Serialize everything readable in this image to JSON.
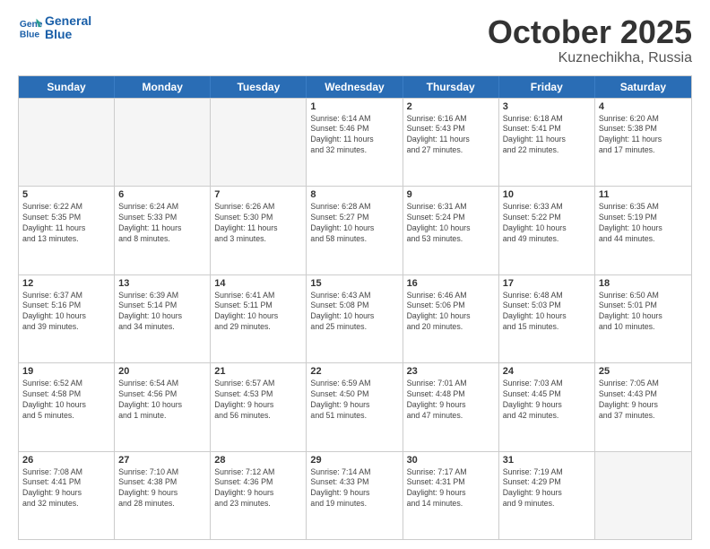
{
  "header": {
    "logo_line1": "General",
    "logo_line2": "Blue",
    "month": "October 2025",
    "location": "Kuznechikha, Russia"
  },
  "days_of_week": [
    "Sunday",
    "Monday",
    "Tuesday",
    "Wednesday",
    "Thursday",
    "Friday",
    "Saturday"
  ],
  "rows": [
    [
      {
        "day": "",
        "info": "",
        "empty": true
      },
      {
        "day": "",
        "info": "",
        "empty": true
      },
      {
        "day": "",
        "info": "",
        "empty": true
      },
      {
        "day": "1",
        "info": "Sunrise: 6:14 AM\nSunset: 5:46 PM\nDaylight: 11 hours\nand 32 minutes."
      },
      {
        "day": "2",
        "info": "Sunrise: 6:16 AM\nSunset: 5:43 PM\nDaylight: 11 hours\nand 27 minutes."
      },
      {
        "day": "3",
        "info": "Sunrise: 6:18 AM\nSunset: 5:41 PM\nDaylight: 11 hours\nand 22 minutes."
      },
      {
        "day": "4",
        "info": "Sunrise: 6:20 AM\nSunset: 5:38 PM\nDaylight: 11 hours\nand 17 minutes."
      }
    ],
    [
      {
        "day": "5",
        "info": "Sunrise: 6:22 AM\nSunset: 5:35 PM\nDaylight: 11 hours\nand 13 minutes."
      },
      {
        "day": "6",
        "info": "Sunrise: 6:24 AM\nSunset: 5:33 PM\nDaylight: 11 hours\nand 8 minutes."
      },
      {
        "day": "7",
        "info": "Sunrise: 6:26 AM\nSunset: 5:30 PM\nDaylight: 11 hours\nand 3 minutes."
      },
      {
        "day": "8",
        "info": "Sunrise: 6:28 AM\nSunset: 5:27 PM\nDaylight: 10 hours\nand 58 minutes."
      },
      {
        "day": "9",
        "info": "Sunrise: 6:31 AM\nSunset: 5:24 PM\nDaylight: 10 hours\nand 53 minutes."
      },
      {
        "day": "10",
        "info": "Sunrise: 6:33 AM\nSunset: 5:22 PM\nDaylight: 10 hours\nand 49 minutes."
      },
      {
        "day": "11",
        "info": "Sunrise: 6:35 AM\nSunset: 5:19 PM\nDaylight: 10 hours\nand 44 minutes."
      }
    ],
    [
      {
        "day": "12",
        "info": "Sunrise: 6:37 AM\nSunset: 5:16 PM\nDaylight: 10 hours\nand 39 minutes."
      },
      {
        "day": "13",
        "info": "Sunrise: 6:39 AM\nSunset: 5:14 PM\nDaylight: 10 hours\nand 34 minutes."
      },
      {
        "day": "14",
        "info": "Sunrise: 6:41 AM\nSunset: 5:11 PM\nDaylight: 10 hours\nand 29 minutes."
      },
      {
        "day": "15",
        "info": "Sunrise: 6:43 AM\nSunset: 5:08 PM\nDaylight: 10 hours\nand 25 minutes."
      },
      {
        "day": "16",
        "info": "Sunrise: 6:46 AM\nSunset: 5:06 PM\nDaylight: 10 hours\nand 20 minutes."
      },
      {
        "day": "17",
        "info": "Sunrise: 6:48 AM\nSunset: 5:03 PM\nDaylight: 10 hours\nand 15 minutes."
      },
      {
        "day": "18",
        "info": "Sunrise: 6:50 AM\nSunset: 5:01 PM\nDaylight: 10 hours\nand 10 minutes."
      }
    ],
    [
      {
        "day": "19",
        "info": "Sunrise: 6:52 AM\nSunset: 4:58 PM\nDaylight: 10 hours\nand 5 minutes."
      },
      {
        "day": "20",
        "info": "Sunrise: 6:54 AM\nSunset: 4:56 PM\nDaylight: 10 hours\nand 1 minute."
      },
      {
        "day": "21",
        "info": "Sunrise: 6:57 AM\nSunset: 4:53 PM\nDaylight: 9 hours\nand 56 minutes."
      },
      {
        "day": "22",
        "info": "Sunrise: 6:59 AM\nSunset: 4:50 PM\nDaylight: 9 hours\nand 51 minutes."
      },
      {
        "day": "23",
        "info": "Sunrise: 7:01 AM\nSunset: 4:48 PM\nDaylight: 9 hours\nand 47 minutes."
      },
      {
        "day": "24",
        "info": "Sunrise: 7:03 AM\nSunset: 4:45 PM\nDaylight: 9 hours\nand 42 minutes."
      },
      {
        "day": "25",
        "info": "Sunrise: 7:05 AM\nSunset: 4:43 PM\nDaylight: 9 hours\nand 37 minutes."
      }
    ],
    [
      {
        "day": "26",
        "info": "Sunrise: 7:08 AM\nSunset: 4:41 PM\nDaylight: 9 hours\nand 32 minutes."
      },
      {
        "day": "27",
        "info": "Sunrise: 7:10 AM\nSunset: 4:38 PM\nDaylight: 9 hours\nand 28 minutes."
      },
      {
        "day": "28",
        "info": "Sunrise: 7:12 AM\nSunset: 4:36 PM\nDaylight: 9 hours\nand 23 minutes."
      },
      {
        "day": "29",
        "info": "Sunrise: 7:14 AM\nSunset: 4:33 PM\nDaylight: 9 hours\nand 19 minutes."
      },
      {
        "day": "30",
        "info": "Sunrise: 7:17 AM\nSunset: 4:31 PM\nDaylight: 9 hours\nand 14 minutes."
      },
      {
        "day": "31",
        "info": "Sunrise: 7:19 AM\nSunset: 4:29 PM\nDaylight: 9 hours\nand 9 minutes."
      },
      {
        "day": "",
        "info": "",
        "empty": true
      }
    ]
  ]
}
